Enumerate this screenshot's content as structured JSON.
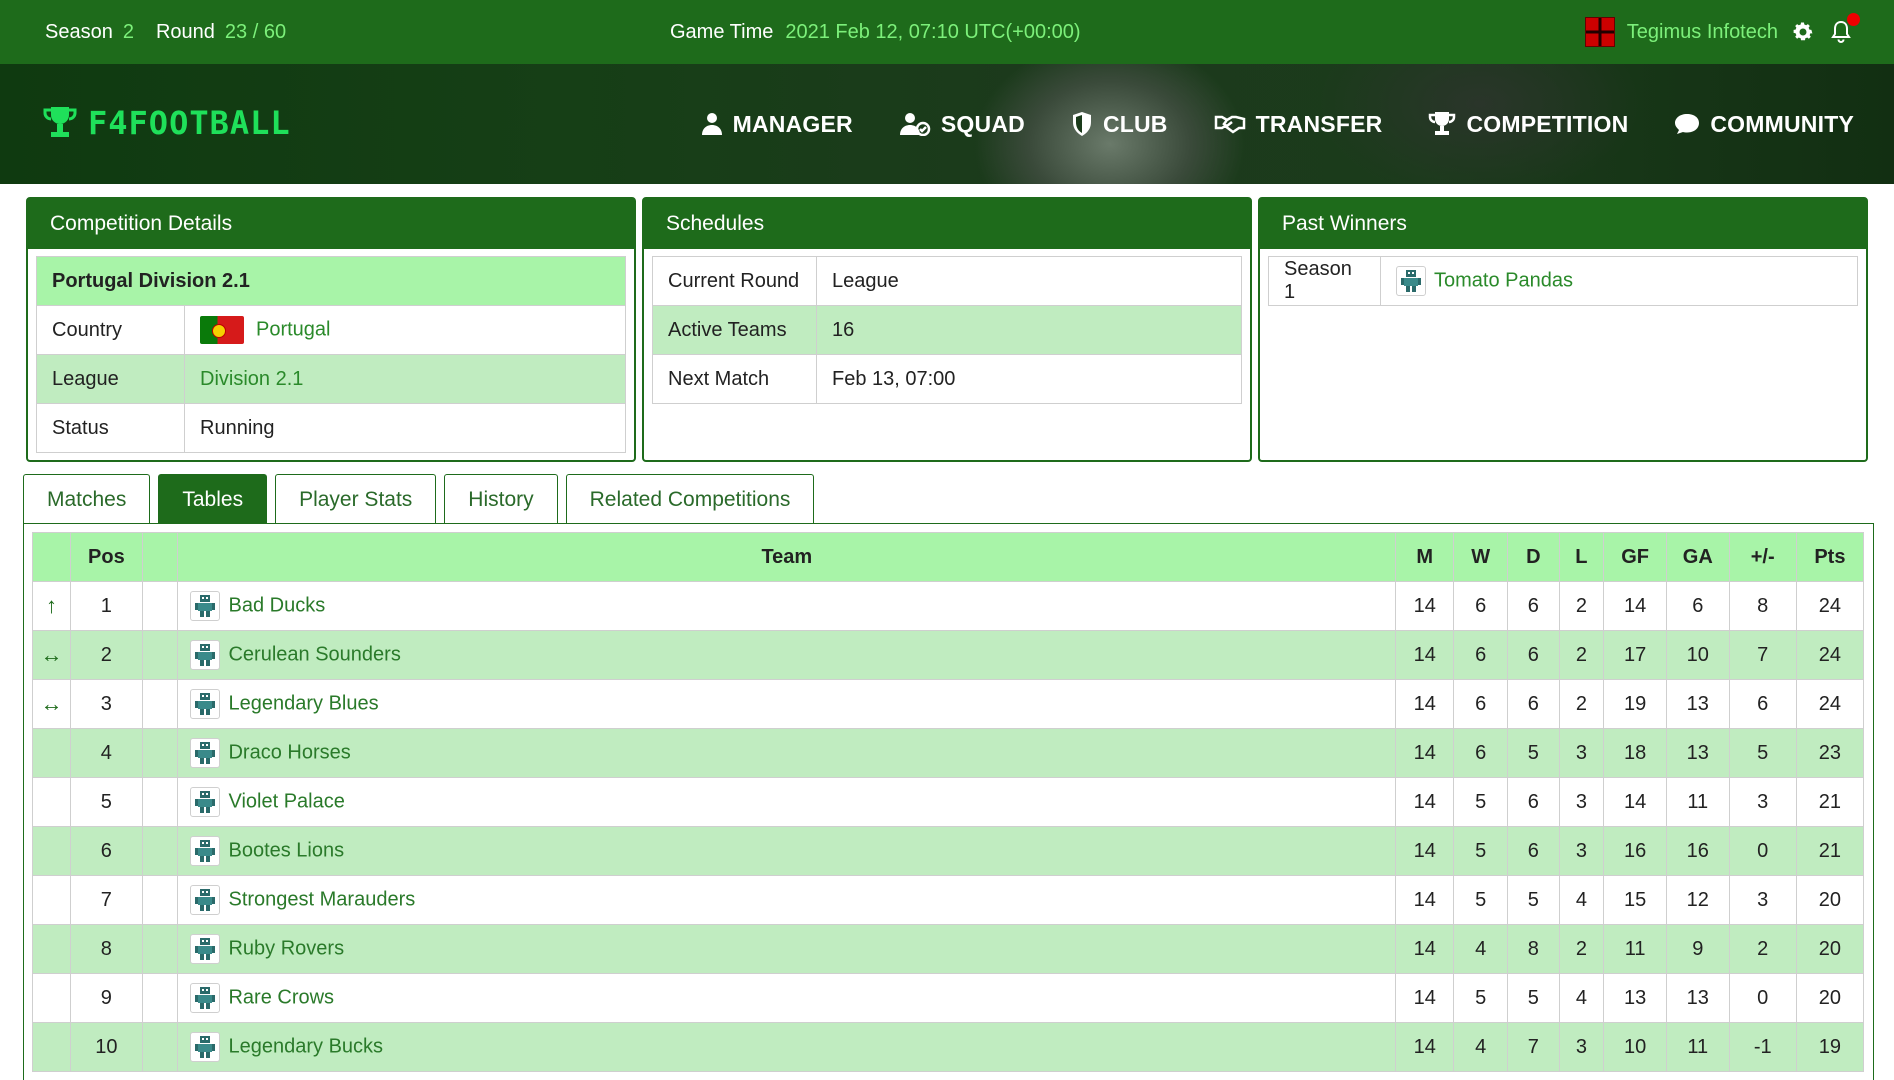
{
  "topbar": {
    "season_label": "Season",
    "season_value": "2",
    "round_label": "Round",
    "round_value": "23 / 60",
    "game_time_label": "Game Time",
    "game_time_value": "2021 Feb 12, 07:10 UTC(+00:00)",
    "user_name": "Tegimus Infotech"
  },
  "brand": {
    "logo_text": "F4FOOTBALL"
  },
  "nav": [
    {
      "label": "MANAGER",
      "icon": "user-icon"
    },
    {
      "label": "SQUAD",
      "icon": "users-icon"
    },
    {
      "label": "CLUB",
      "icon": "shield-icon"
    },
    {
      "label": "TRANSFER",
      "icon": "handshake-icon"
    },
    {
      "label": "COMPETITION",
      "icon": "trophy-icon"
    },
    {
      "label": "COMMUNITY",
      "icon": "chat-icon"
    }
  ],
  "competition": {
    "title": "Competition Details",
    "name": "Portugal Division 2.1",
    "rows": [
      {
        "label": "Country",
        "value": "Portugal"
      },
      {
        "label": "League",
        "value": "Division 2.1"
      },
      {
        "label": "Status",
        "value": "Running"
      }
    ]
  },
  "schedules": {
    "title": "Schedules",
    "rows": [
      {
        "label": "Current Round",
        "value": "League"
      },
      {
        "label": "Active Teams",
        "value": "16"
      },
      {
        "label": "Next Match",
        "value": "Feb 13, 07:00"
      }
    ]
  },
  "past_winners": {
    "title": "Past Winners",
    "rows": [
      {
        "season": "Season 1",
        "team": "Tomato Pandas"
      }
    ]
  },
  "tabs": [
    {
      "label": "Matches",
      "active": false
    },
    {
      "label": "Tables",
      "active": true
    },
    {
      "label": "Player Stats",
      "active": false
    },
    {
      "label": "History",
      "active": false
    },
    {
      "label": "Related Competitions",
      "active": false
    }
  ],
  "table": {
    "headers": {
      "pos": "Pos",
      "team": "Team",
      "m": "M",
      "w": "W",
      "d": "D",
      "l": "L",
      "gf": "GF",
      "ga": "GA",
      "gd": "+/-",
      "pts": "Pts"
    },
    "rows": [
      {
        "trend": "up",
        "pos": "1",
        "team": "Bad Ducks",
        "m": "14",
        "w": "6",
        "d": "6",
        "l": "2",
        "gf": "14",
        "ga": "6",
        "gd": "8",
        "pts": "24"
      },
      {
        "trend": "same",
        "pos": "2",
        "team": "Cerulean Sounders",
        "m": "14",
        "w": "6",
        "d": "6",
        "l": "2",
        "gf": "17",
        "ga": "10",
        "gd": "7",
        "pts": "24"
      },
      {
        "trend": "same",
        "pos": "3",
        "team": "Legendary Blues",
        "m": "14",
        "w": "6",
        "d": "6",
        "l": "2",
        "gf": "19",
        "ga": "13",
        "gd": "6",
        "pts": "24"
      },
      {
        "trend": "",
        "pos": "4",
        "team": "Draco Horses",
        "m": "14",
        "w": "6",
        "d": "5",
        "l": "3",
        "gf": "18",
        "ga": "13",
        "gd": "5",
        "pts": "23"
      },
      {
        "trend": "",
        "pos": "5",
        "team": "Violet Palace",
        "m": "14",
        "w": "5",
        "d": "6",
        "l": "3",
        "gf": "14",
        "ga": "11",
        "gd": "3",
        "pts": "21"
      },
      {
        "trend": "",
        "pos": "6",
        "team": "Bootes Lions",
        "m": "14",
        "w": "5",
        "d": "6",
        "l": "3",
        "gf": "16",
        "ga": "16",
        "gd": "0",
        "pts": "21"
      },
      {
        "trend": "",
        "pos": "7",
        "team": "Strongest Marauders",
        "m": "14",
        "w": "5",
        "d": "5",
        "l": "4",
        "gf": "15",
        "ga": "12",
        "gd": "3",
        "pts": "20"
      },
      {
        "trend": "",
        "pos": "8",
        "team": "Ruby Rovers",
        "m": "14",
        "w": "4",
        "d": "8",
        "l": "2",
        "gf": "11",
        "ga": "9",
        "gd": "2",
        "pts": "20"
      },
      {
        "trend": "",
        "pos": "9",
        "team": "Rare Crows",
        "m": "14",
        "w": "5",
        "d": "5",
        "l": "4",
        "gf": "13",
        "ga": "13",
        "gd": "0",
        "pts": "20"
      },
      {
        "trend": "",
        "pos": "10",
        "team": "Legendary Bucks",
        "m": "14",
        "w": "4",
        "d": "7",
        "l": "3",
        "gf": "10",
        "ga": "11",
        "gd": "-1",
        "pts": "19"
      }
    ]
  }
}
